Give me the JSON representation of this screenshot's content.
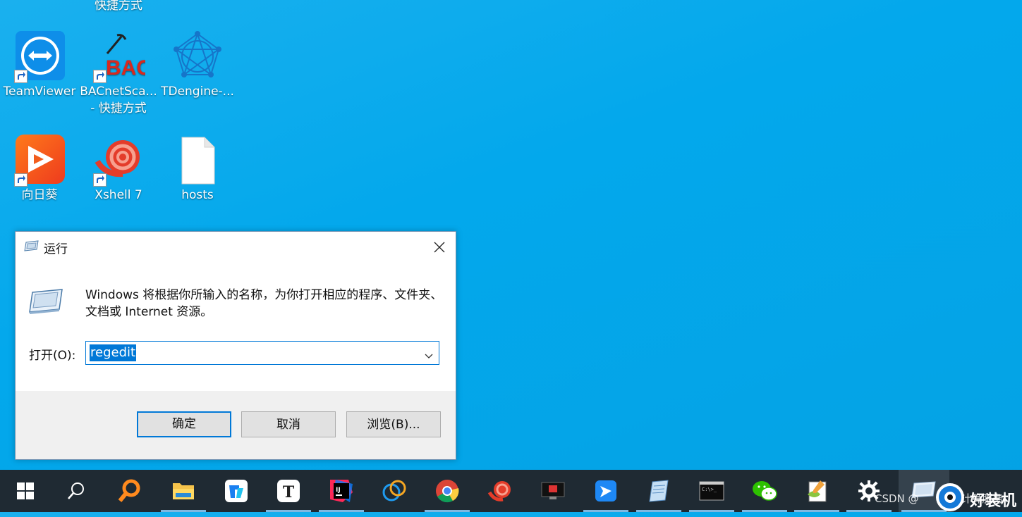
{
  "desktop": {
    "top_label": "快捷方式",
    "icons": [
      {
        "label": "TeamViewer"
      },
      {
        "label": "BACnetSca...",
        "label2": "- 快捷方式",
        "logo_text": "BAC"
      },
      {
        "label": "TDengine-..."
      },
      {
        "label": "向日葵"
      },
      {
        "label": "Xshell 7"
      },
      {
        "label": "hosts"
      }
    ]
  },
  "run_dialog": {
    "title": "运行",
    "description": "Windows 将根据你所输入的名称，为你打开相应的程序、文件夹、文档或 Internet 资源。",
    "open_label": "打开(O):",
    "input_value": "regedit",
    "ok_label": "确定",
    "cancel_label": "取消",
    "browse_label": "浏览(B)..."
  },
  "taskbar": {
    "items": [
      "start-icon",
      "search-icon",
      "everything-icon",
      "file-explorer-icon",
      "app-icon",
      "typora-icon",
      "intellij-idea-icon",
      "network-app-icon",
      "chrome-icon",
      "xshell-icon",
      "rdp-icon",
      "feishu-icon",
      "notepad-icon",
      "cmd-icon",
      "wechat-icon",
      "notepad-plus-plus-icon",
      "settings-icon",
      "run-icon"
    ],
    "colors": {
      "background": "#1f2a33",
      "accent": "#0078d7"
    }
  },
  "watermark": {
    "small_text": "CSDN @",
    "brand": "好装机",
    "partial": "云计算服务"
  }
}
